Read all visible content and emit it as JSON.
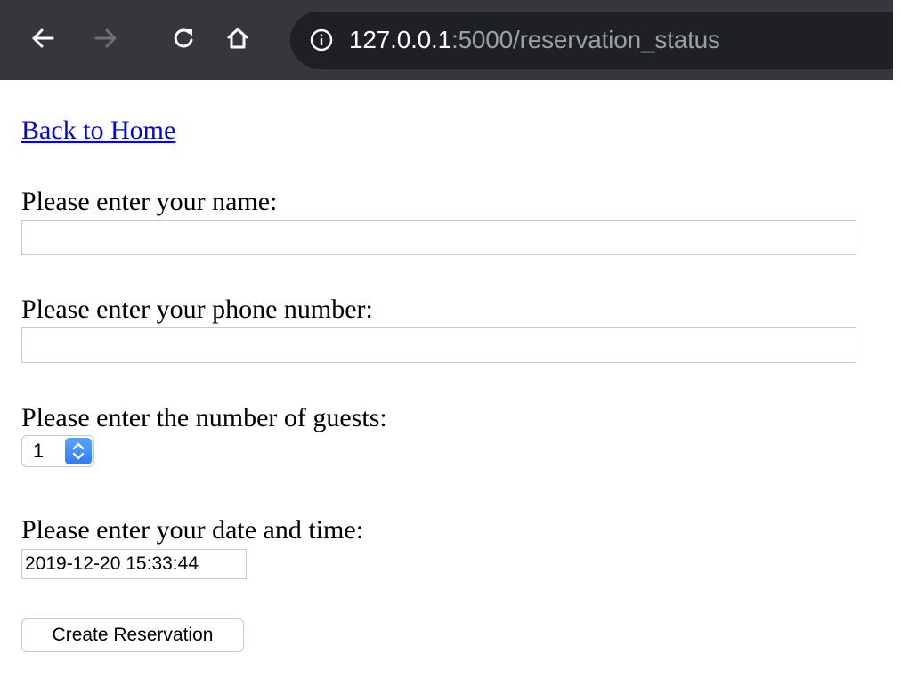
{
  "browser": {
    "back_icon": "arrow-left-icon",
    "forward_icon": "arrow-right-icon",
    "reload_icon": "reload-icon",
    "home_icon": "home-icon",
    "info_icon": "info-icon",
    "url_host": "127.0.0.1",
    "url_rest": ":5000/reservation_status",
    "toolbar_color": "#36373a",
    "omnibox_color": "#1f2023"
  },
  "page": {
    "home_link": "Back to Home",
    "name_label": "Please enter your name:",
    "name_value": "",
    "phone_label": "Please enter your phone number:",
    "phone_value": "",
    "guests_label": "Please enter the number of guests:",
    "guests_value": "1",
    "datetime_label": "Please enter your date and time:",
    "datetime_value": "2019-12-20 15:33:44",
    "submit_label": "Create Reservation",
    "link_color": "#0000ee",
    "accent_color": "#2f7df6"
  }
}
